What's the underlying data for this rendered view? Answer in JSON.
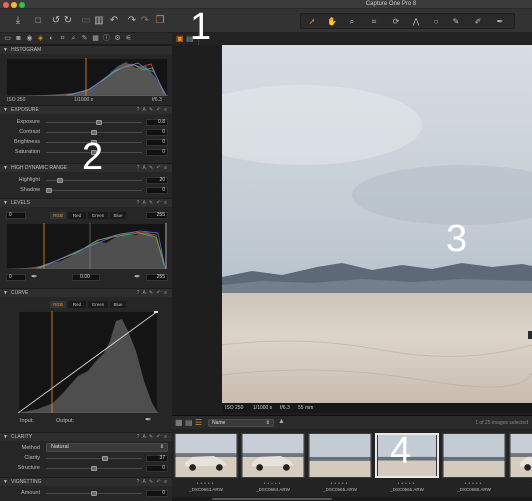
{
  "app_title": "Capture One Pro 8",
  "colors": {
    "accent": "#f08a24",
    "panel_bg": "#262626",
    "header_bg": "#2e2e2e"
  },
  "toolbar": {
    "left_icons": [
      "import-icon",
      "camera-icon",
      "undo-icon",
      "redo-icon",
      "trash-icon",
      "rotate-left-icon",
      "rotate-right-icon",
      "copy-icon"
    ],
    "cursor_tools": [
      "pointer-icon",
      "pan-icon",
      "loupe-icon",
      "crop-icon",
      "rotate-icon",
      "keystone-icon",
      "spot-icon",
      "brush-icon",
      "eraser-icon",
      "gradient-icon"
    ]
  },
  "annotations": {
    "n1": "1",
    "n2": "2",
    "n3": "3",
    "n4": "4"
  },
  "histogram": {
    "title": "HISTOGRAM",
    "iso": "ISO 250",
    "shutter": "1/1000 s",
    "aperture": "f/6.3"
  },
  "exposure": {
    "title": "EXPOSURE",
    "rows": [
      {
        "label": "Exposure",
        "value": "0.8",
        "pos": 0.56
      },
      {
        "label": "Contrast",
        "value": "0",
        "pos": 0.5
      },
      {
        "label": "Brightness",
        "value": "0",
        "pos": 0.5
      },
      {
        "label": "Saturation",
        "value": "0",
        "pos": 0.5
      }
    ]
  },
  "hdr": {
    "title": "HIGH DYNAMIC RANGE",
    "rows": [
      {
        "label": "Highlight",
        "value": "20",
        "pos": 0.12
      },
      {
        "label": "Shadow",
        "value": "0",
        "pos": 0.0
      }
    ]
  },
  "levels": {
    "title": "LEVELS",
    "tabs": [
      "RGB",
      "Red",
      "Green",
      "Blue"
    ],
    "left_top": "0",
    "right_top": "255",
    "left_bottom": "0",
    "mid_bottom": "0.00",
    "right_bottom": "255"
  },
  "curve": {
    "title": "CURVE",
    "tabs": [
      "RGB",
      "Red",
      "Green",
      "Blue"
    ],
    "input_label": "Input:",
    "output_label": "Output:"
  },
  "clarity": {
    "title": "CLARITY",
    "method_label": "Method",
    "method_value": "Natural",
    "rows": [
      {
        "label": "Clarity",
        "value": "37",
        "pos": 0.62
      },
      {
        "label": "Structure",
        "value": "0",
        "pos": 0.5
      }
    ]
  },
  "vignetting": {
    "title": "VIGNETTING",
    "rows": [
      {
        "label": "Amount",
        "value": "0",
        "pos": 0.5
      }
    ]
  },
  "viewer": {
    "exif": {
      "iso": "ISO 250",
      "shutter": "1/1000 s",
      "aperture": "f/6.3",
      "focal": "55 mm"
    }
  },
  "browser": {
    "sort_label": "Name",
    "count_text": "1 of 25 images selected",
    "thumbs": [
      {
        "name": "_DSC0663.ARW",
        "style": "car"
      },
      {
        "name": "_DSC0664.ARW",
        "style": "car"
      },
      {
        "name": "_DSC0665.ARW",
        "style": "desert"
      },
      {
        "name": "_DSC0666.ARW",
        "style": "desert"
      },
      {
        "name": "_DSC0668.ARW",
        "style": "desert"
      },
      {
        "name": "_DSC0",
        "style": "car"
      }
    ],
    "selected_index": 3
  }
}
